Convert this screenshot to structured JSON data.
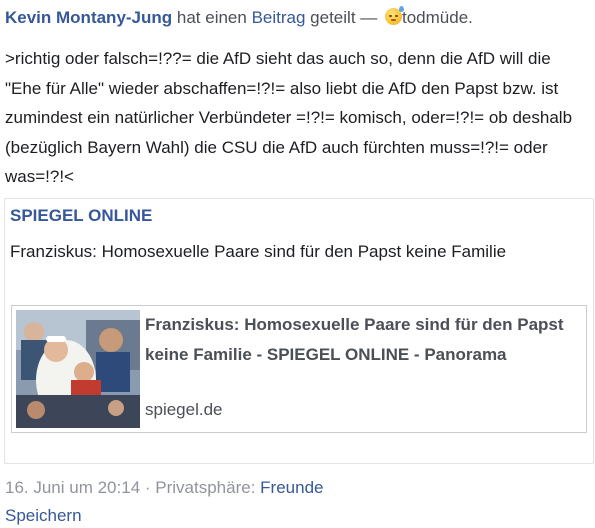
{
  "post": {
    "author": "Kevin Montany-Jung",
    "action_text": " hat einen ",
    "object_link": "Beitrag",
    "shared_text": " geteilt — ",
    "feeling_icon": "sleepy-face-emoji",
    "feeling": "todmüde.",
    "text": ">richtig oder falsch=!??= die AfD sieht das auch so, denn die AfD will die \"Ehe für Alle\" wieder abschaffen=!?!= also liebt die AfD den Papst bzw. ist zumindest ein natürlicher Verbündeter =!?!= komisch, oder=!?!= ob deshalb (bezüglich Bayern Wahl) die CSU die AfD auch fürchten muss=!?!= oder was=!?!<"
  },
  "shared": {
    "source": "SPIEGEL ONLINE",
    "description": "Franziskus: Homosexuelle Paare sind für den Papst keine Familie",
    "card": {
      "title": "Franziskus: Homosexuelle Paare sind für den Papst keine Familie - SPIEGEL ONLINE - Panorama",
      "domain": "spiegel.de",
      "thumbnail": "photo of Pope greeting crowd"
    }
  },
  "footer": {
    "timestamp": "16. Juni um 20:14",
    "separator": " · ",
    "privacy_label": "Privatsphäre: ",
    "privacy_value": "Freunde",
    "save_label": "Speichern"
  },
  "colors": {
    "link": "#365899",
    "text": "#1c1e21",
    "muted": "#90949c",
    "border": "#c9ccd1"
  }
}
